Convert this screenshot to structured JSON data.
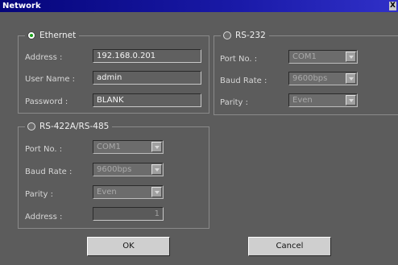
{
  "window": {
    "title": "Network",
    "close_glyph": "X"
  },
  "ethernet": {
    "label": "Ethernet",
    "selected": true,
    "address_label": "Address :",
    "address_value": "192.168.0.201",
    "username_label": "User Name :",
    "username_value": "admin",
    "password_label": "Password :",
    "password_value": "BLANK"
  },
  "rs232": {
    "label": "RS-232",
    "selected": false,
    "port_label": "Port No. :",
    "port_value": "COM1",
    "baud_label": "Baud Rate :",
    "baud_value": "9600bps",
    "parity_label": "Parity :",
    "parity_value": "Even"
  },
  "rs422": {
    "label": "RS-422A/RS-485",
    "selected": false,
    "port_label": "Port No. :",
    "port_value": "COM1",
    "baud_label": "Baud Rate :",
    "baud_value": "9600bps",
    "parity_label": "Parity :",
    "parity_value": "Even",
    "address_label": "Address :",
    "address_value": "1"
  },
  "buttons": {
    "ok": "OK",
    "cancel": "Cancel"
  },
  "icons": {
    "dropdown": "chevron-down-icon",
    "radio": "radio-button"
  }
}
